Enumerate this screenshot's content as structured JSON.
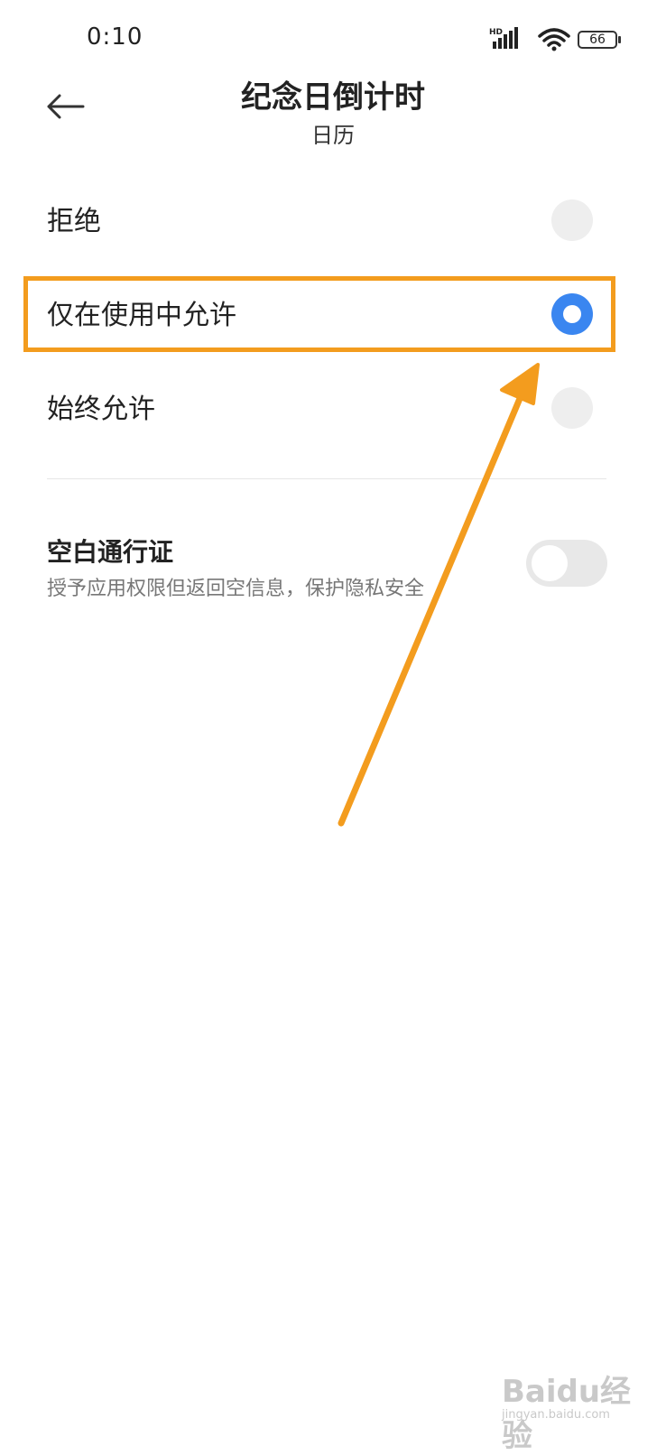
{
  "status_bar": {
    "time": "0:10",
    "battery": "66",
    "icons": [
      "hd-signal-icon",
      "wifi-icon",
      "battery-icon"
    ]
  },
  "header": {
    "title": "纪念日倒计时",
    "subtitle": "日历",
    "back_icon": "arrow-left-icon"
  },
  "options": [
    {
      "label": "拒绝",
      "selected": false
    },
    {
      "label": "仅在使用中允许",
      "selected": true
    },
    {
      "label": "始终允许",
      "selected": false
    }
  ],
  "blank_pass": {
    "title": "空白通行证",
    "description": "授予应用权限但返回空信息，保护隐私安全",
    "enabled": false
  },
  "colors": {
    "accent": "#3a86f0",
    "annotation": "#f39c1e",
    "radio_off": "#eeeeee"
  },
  "watermark": {
    "text": "Baidu经验",
    "sub": "jingyan.baidu.com"
  }
}
